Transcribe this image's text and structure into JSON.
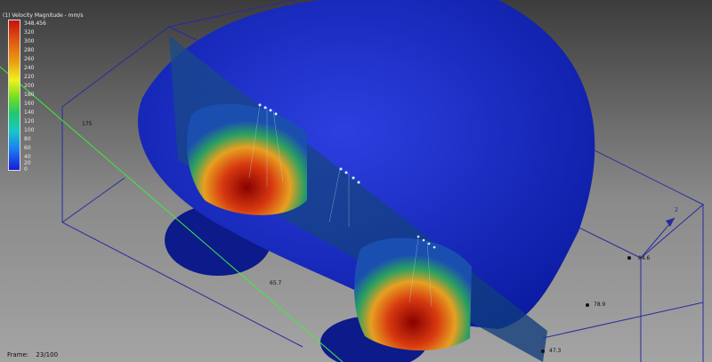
{
  "legend": {
    "title": "(1) Velocity Magnitude - mm/s",
    "ticks": [
      "348.456",
      "320",
      "300",
      "280",
      "260",
      "240",
      "220",
      "200",
      "180",
      "160",
      "140",
      "120",
      "100",
      "80",
      "60",
      "40",
      "20",
      "0"
    ]
  },
  "dimensions": {
    "d1": "175",
    "d2": "65.7",
    "d3": "78.9",
    "d4": "84.6",
    "d5": "47.3",
    "axis_label": "Z"
  },
  "frame": {
    "label": "Frame:",
    "value": "23/100"
  },
  "colors": {
    "background_top": "#3c3c3c",
    "background_bottom": "#a4a4a4",
    "mesh_blue": "#1c2fc6",
    "wireframe": "#2a2aa0",
    "guide_line": "#3cf03c"
  }
}
